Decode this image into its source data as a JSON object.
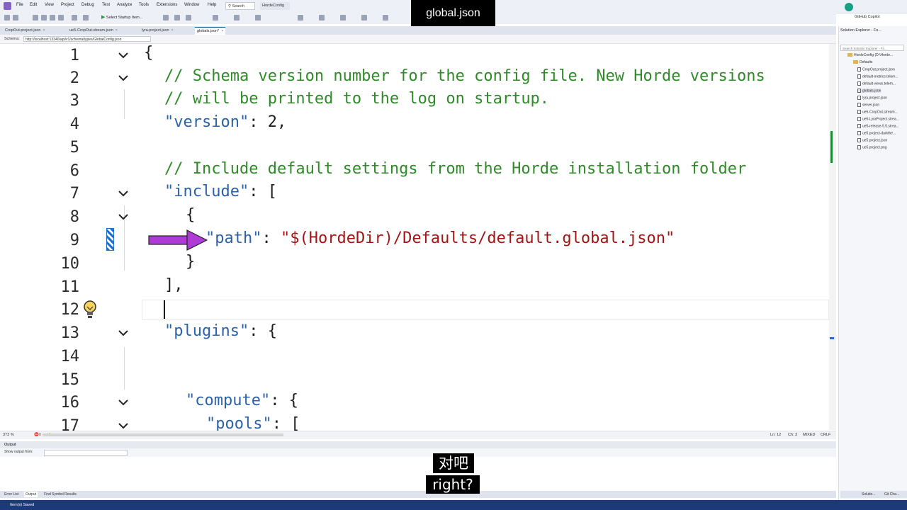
{
  "overlay_title": "global.json",
  "menu": [
    "File",
    "Edit",
    "View",
    "Project",
    "Debug",
    "Test",
    "Analyze",
    "Tools",
    "Extensions",
    "Window",
    "Help"
  ],
  "search_label": "Search",
  "solution_name": "HordeConfig",
  "toolbar": {
    "start_label": "Select Startup Item..."
  },
  "copilot_label": "GitHub Copilot",
  "tabs": [
    {
      "label": "CropOut.project.json"
    },
    {
      "label": "ue5-CropOut.stream.json"
    },
    {
      "label": "lyra.project.json"
    },
    {
      "label": "globals.json*",
      "active": true
    }
  ],
  "schema": {
    "label": "Schema:",
    "url": "http://localhost:13340/api/v1/schema/types/GlobalConfig.json"
  },
  "editor": {
    "lines": [
      {
        "n": "1"
      },
      {
        "n": "2"
      },
      {
        "n": "3"
      },
      {
        "n": "4"
      },
      {
        "n": "5"
      },
      {
        "n": "6"
      },
      {
        "n": "7"
      },
      {
        "n": "8"
      },
      {
        "n": "9"
      },
      {
        "n": "10"
      },
      {
        "n": "11"
      },
      {
        "n": "12"
      },
      {
        "n": "13"
      },
      {
        "n": "14"
      },
      {
        "n": "15"
      },
      {
        "n": "16"
      },
      {
        "n": "17"
      }
    ],
    "code": {
      "l1": "{",
      "l2": "// Schema version number for the config file. New Horde versions",
      "l3": "// will be printed to the log on startup.",
      "l4_key": "\"version\"",
      "l4_rest": ": 2,",
      "l6": "// Include default settings from the Horde installation folder",
      "l7_key": "\"include\"",
      "l7_rest": ": [",
      "l8": "{",
      "l9_key": "\"path\"",
      "l9_colon": ": ",
      "l9_val": "\"$(HordeDir)/Defaults/default.global.json\"",
      "l10": "}",
      "l11": "],",
      "l13_key": "\"plugins\"",
      "l13_rest": ": {",
      "l16_key": "\"compute\"",
      "l16_rest": ": {",
      "l17_key": "\"pools\"",
      "l17_rest": ": ["
    }
  },
  "editor_status": {
    "zoom": "373 %",
    "errors": "0",
    "warnings": "1",
    "line": "Ln: 12",
    "col": "Ch: 3",
    "mixed": "MIXED",
    "eol": "CRLF"
  },
  "output": {
    "title": "Output",
    "show_from": "Show output from:"
  },
  "bottom_tabs": [
    "Error List",
    "Output",
    "Find Symbol Results"
  ],
  "status_text": "Item(s) Saved",
  "solution_explorer": {
    "title": "Solution Explorer - Fo...",
    "search_placeholder": "Search Solution Explorer - Fo...",
    "root": "HordeConfig (D:\\Horde...",
    "folder": "Defaults",
    "files": [
      "CropOut.project.json",
      "default-metrics.telem...",
      "default-views.telem...",
      "globals.json",
      "lyra.project.json",
      "server.json",
      "ue5-CropOut.stream...",
      "ue5-LyraProject.strea...",
      "ue5-release-5.5.strea...",
      "ue5.project-darkthe...",
      "ue5.project.json",
      "ue5.project.png"
    ],
    "selected_index": 3,
    "bottom_tabs": [
      "Solutio...",
      "Git Cha..."
    ]
  },
  "subtitles": {
    "zh": "对吧",
    "en": "right?"
  }
}
